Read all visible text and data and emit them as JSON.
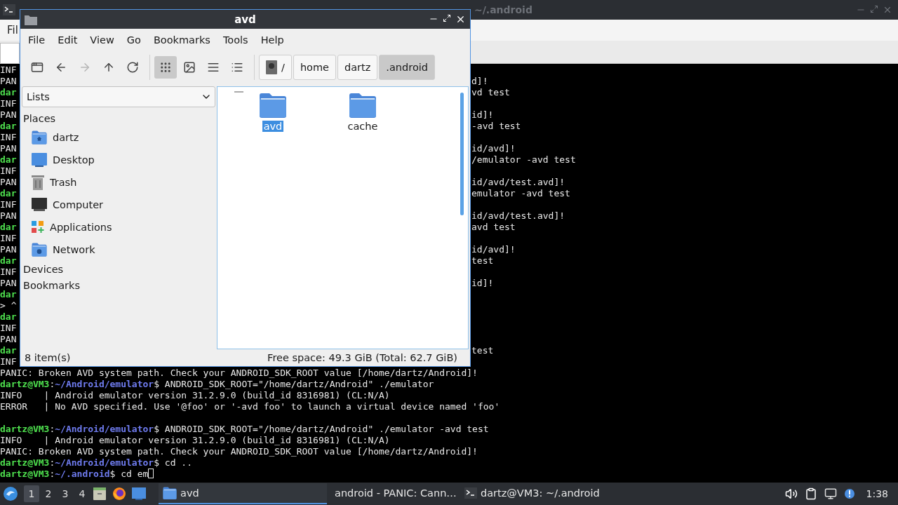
{
  "terminal": {
    "title": "~/.android",
    "menu_fragment": "Fil",
    "lines": [
      {
        "kind": "split",
        "left": "INF",
        "left_prompt": false
      },
      {
        "kind": "split",
        "left": "PAN",
        "left_prompt": false,
        "right": "d]!"
      },
      {
        "kind": "split",
        "left": "dar",
        "left_prompt": true,
        "right": "vd test"
      },
      {
        "kind": "split",
        "left": "INF",
        "left_prompt": false
      },
      {
        "kind": "split",
        "left": "PAN",
        "left_prompt": false,
        "right": "id]!"
      },
      {
        "kind": "split",
        "left": "dar",
        "left_prompt": true,
        "right": "-avd test"
      },
      {
        "kind": "split",
        "left": "INF",
        "left_prompt": false
      },
      {
        "kind": "split",
        "left": "PAN",
        "left_prompt": false,
        "right": "id/avd]!"
      },
      {
        "kind": "split",
        "left": "dar",
        "left_prompt": true,
        "right": "/emulator -avd test"
      },
      {
        "kind": "split",
        "left": "INF",
        "left_prompt": false
      },
      {
        "kind": "split",
        "left": "PAN",
        "left_prompt": false,
        "right": "id/avd/test.avd]!"
      },
      {
        "kind": "split",
        "left": "dar",
        "left_prompt": true,
        "right": "emulator -avd test"
      },
      {
        "kind": "split",
        "left": "INF",
        "left_prompt": false
      },
      {
        "kind": "split",
        "left": "PAN",
        "left_prompt": false,
        "right": "id/avd/test.avd]!"
      },
      {
        "kind": "split",
        "left": "dar",
        "left_prompt": true,
        "right": "avd test"
      },
      {
        "kind": "split",
        "left": "INF",
        "left_prompt": false
      },
      {
        "kind": "split",
        "left": "PAN",
        "left_prompt": false,
        "right": "id/avd]!"
      },
      {
        "kind": "split",
        "left": "dar",
        "left_prompt": true,
        "right": "test"
      },
      {
        "kind": "split",
        "left": "INF",
        "left_prompt": false
      },
      {
        "kind": "split",
        "left": "PAN",
        "left_prompt": false,
        "right": "id]!"
      },
      {
        "kind": "split",
        "left": "dar",
        "left_prompt": true
      },
      {
        "kind": "split",
        "left": "> ^",
        "left_prompt": false
      },
      {
        "kind": "split",
        "left": "dar",
        "left_prompt": true
      },
      {
        "kind": "split",
        "left": "INF",
        "left_prompt": false
      },
      {
        "kind": "split",
        "left": "PAN",
        "left_prompt": false
      },
      {
        "kind": "split",
        "left": "dar",
        "left_prompt": true,
        "right": "test"
      },
      {
        "kind": "split",
        "left": "INF",
        "left_prompt": false
      },
      {
        "kind": "output",
        "text": "PANIC: Broken AVD system path. Check your ANDROID_SDK_ROOT value [/home/dartz/Android]!"
      },
      {
        "kind": "prompt",
        "host": "dartz@VM3",
        "sep": ":",
        "path": "~/Android/emulator",
        "sign": "$",
        "command": " ANDROID_SDK_ROOT=\"/home/dartz/Android\" ./emulator"
      },
      {
        "kind": "output",
        "text": "INFO    | Android emulator version 31.2.9.0 (build_id 8316981) (CL:N/A)"
      },
      {
        "kind": "output",
        "text": "ERROR   | No AVD specified. Use '@foo' or '-avd foo' to launch a virtual device named 'foo'"
      },
      {
        "kind": "blank"
      },
      {
        "kind": "prompt",
        "host": "dartz@VM3",
        "sep": ":",
        "path": "~/Android/emulator",
        "sign": "$",
        "command": " ANDROID_SDK_ROOT=\"/home/dartz/Android\" ./emulator -avd test"
      },
      {
        "kind": "output",
        "text": "INFO    | Android emulator version 31.2.9.0 (build_id 8316981) (CL:N/A)"
      },
      {
        "kind": "output",
        "text": "PANIC: Broken AVD system path. Check your ANDROID_SDK_ROOT value [/home/dartz/Android]!"
      },
      {
        "kind": "prompt",
        "host": "dartz@VM3",
        "sep": ":",
        "path": "~/Android/emulator",
        "sign": "$",
        "command": " cd .."
      },
      {
        "kind": "prompt",
        "host": "dartz@VM3",
        "sep": ":",
        "path": "~/.android",
        "sign": "$",
        "command": " cd em",
        "cursor": true
      }
    ]
  },
  "file_manager": {
    "title": "avd",
    "menu": [
      "File",
      "Edit",
      "View",
      "Go",
      "Bookmarks",
      "Tools",
      "Help"
    ],
    "nav": [
      {
        "kind": "new_tab",
        "disabled": false
      },
      {
        "kind": "back",
        "disabled": false
      },
      {
        "kind": "forward",
        "disabled": true
      },
      {
        "kind": "up",
        "disabled": false
      },
      {
        "kind": "reload",
        "disabled": false
      }
    ],
    "views": [
      {
        "kind": "icons",
        "selected": true
      },
      {
        "kind": "thumbnails",
        "selected": false
      },
      {
        "kind": "compact",
        "selected": false
      },
      {
        "kind": "details",
        "selected": false
      }
    ],
    "path": [
      {
        "kind": "root",
        "label": "/",
        "selected": false
      },
      {
        "kind": "dir",
        "label": "home",
        "selected": false
      },
      {
        "kind": "dir",
        "label": "dartz",
        "selected": false
      },
      {
        "kind": "dir",
        "label": ".android",
        "selected": true
      }
    ],
    "sidebar": {
      "dropdown": "Lists",
      "sections": [
        {
          "title": "Places",
          "items": [
            {
              "kind": "home",
              "label": "dartz"
            },
            {
              "kind": "desktop",
              "label": "Desktop"
            },
            {
              "kind": "trash",
              "label": "Trash"
            },
            {
              "kind": "computer",
              "label": "Computer"
            },
            {
              "kind": "applications",
              "label": "Applications"
            },
            {
              "kind": "network",
              "label": "Network"
            }
          ]
        },
        {
          "title": "Devices"
        },
        {
          "title": "Bookmarks"
        }
      ]
    },
    "files": [
      {
        "name": "avd",
        "selected": true
      },
      {
        "name": "cache",
        "selected": false
      }
    ],
    "status": {
      "count": "8 item(s)",
      "space": "Free space: 49.3 GiB (Total: 62.7 GiB)"
    }
  },
  "taskbar": {
    "workspaces": [
      {
        "label": "1",
        "selected": true
      },
      {
        "label": "2",
        "selected": false
      },
      {
        "label": "3",
        "selected": false
      },
      {
        "label": "4",
        "selected": false
      }
    ],
    "launchers": [
      {
        "kind": "files"
      },
      {
        "kind": "firefox"
      },
      {
        "kind": "desktop"
      }
    ],
    "tasks": [
      {
        "kind": "folder",
        "label": "avd",
        "selected": true
      },
      {
        "kind": "firefox",
        "label": "android - PANIC: Cann…",
        "selected": false
      },
      {
        "kind": "terminal",
        "label": "dartz@VM3: ~/.android",
        "selected": false
      }
    ],
    "tray": [
      {
        "kind": "volume"
      },
      {
        "kind": "clipboard"
      },
      {
        "kind": "network"
      },
      {
        "kind": "notification"
      }
    ],
    "clock": "1:38"
  }
}
